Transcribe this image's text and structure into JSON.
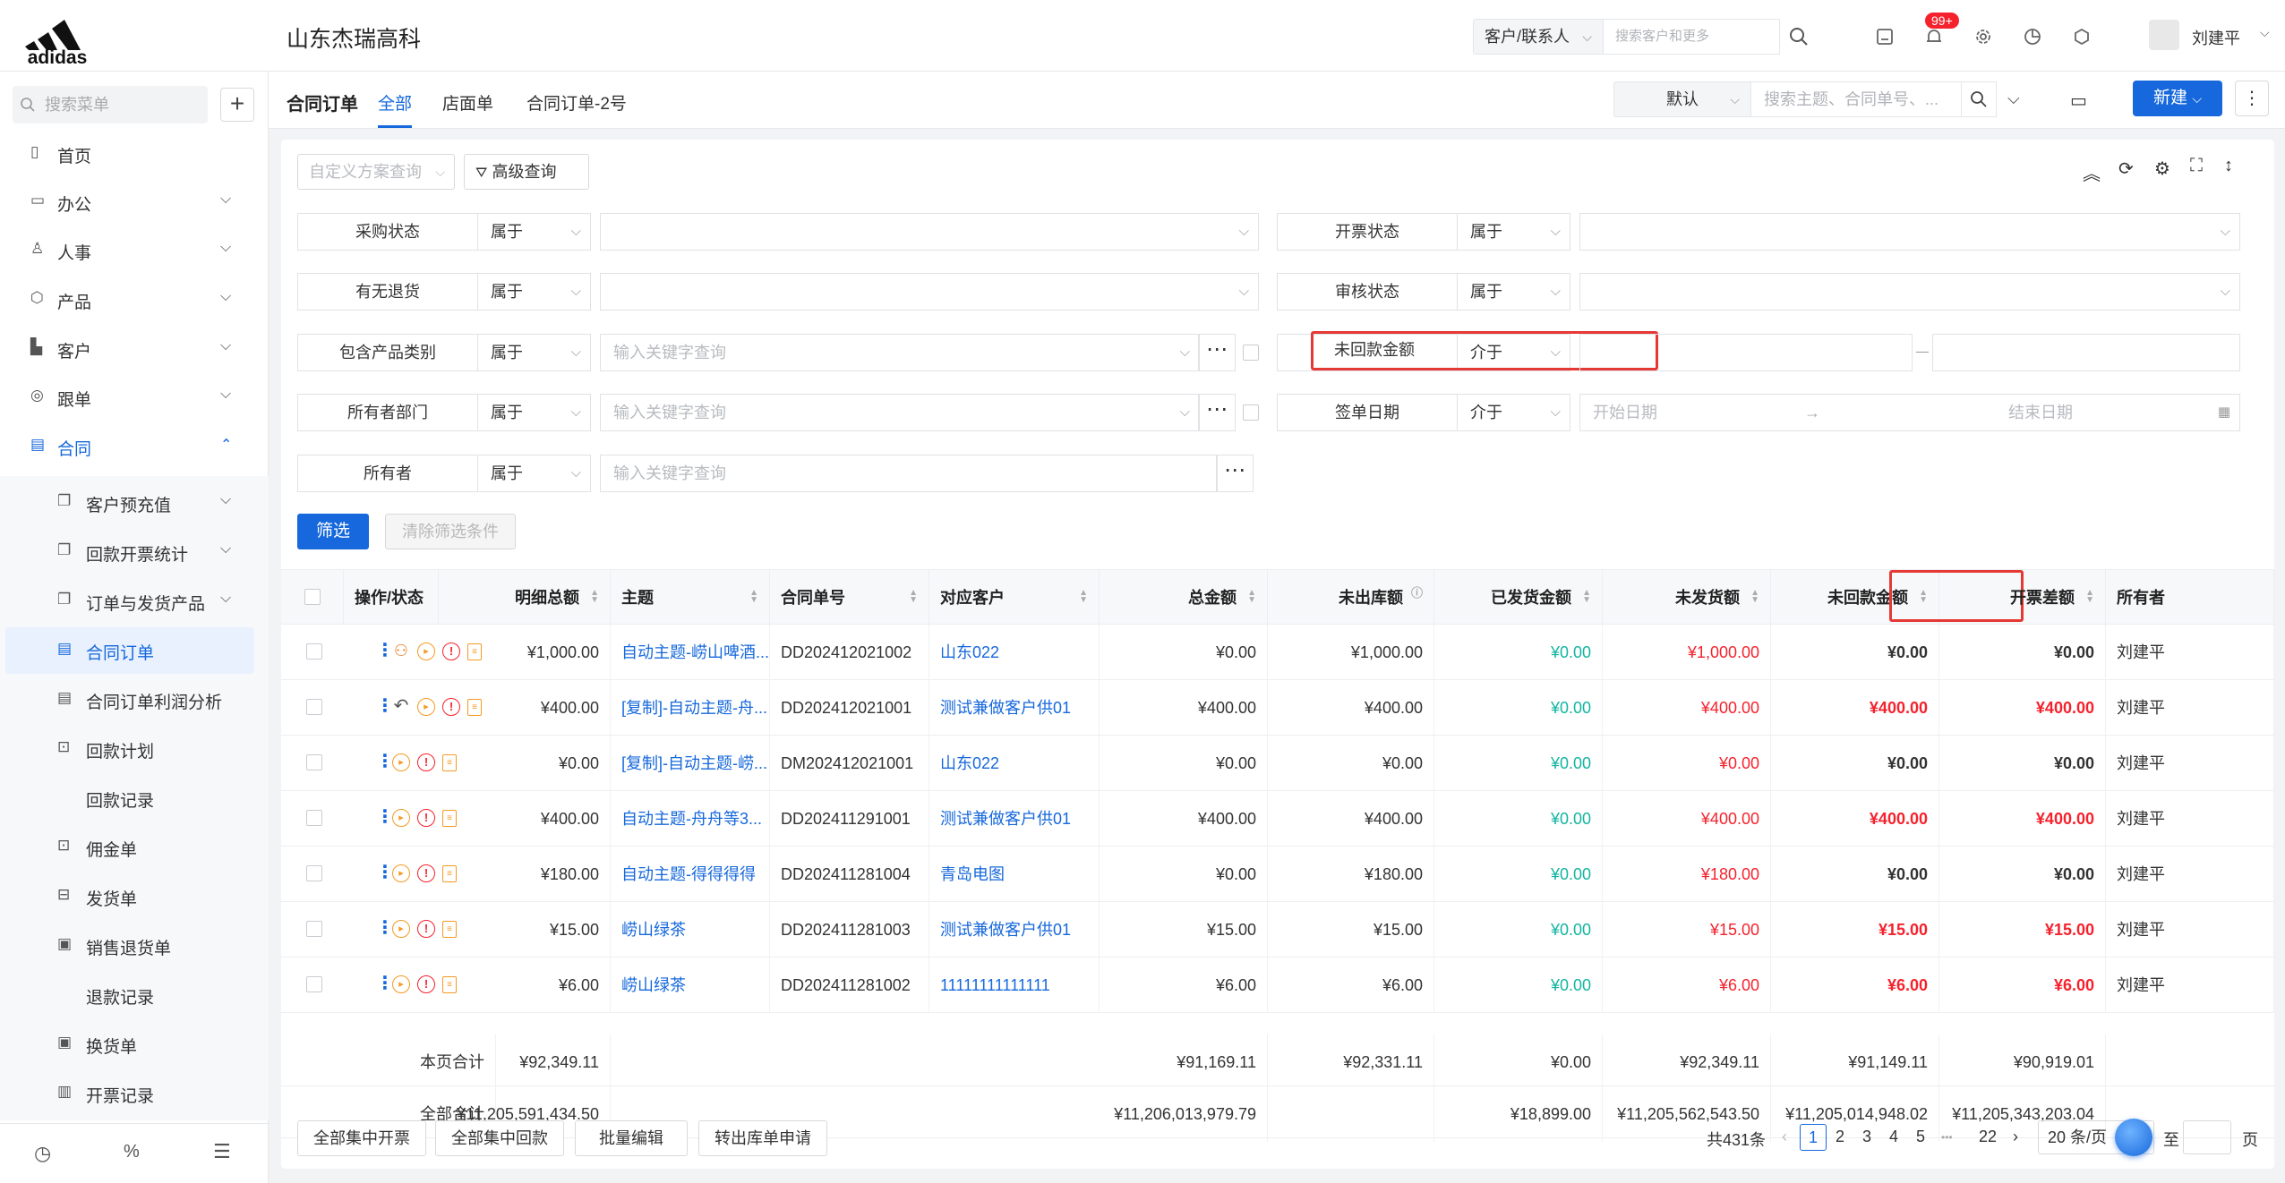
{
  "brand": {
    "logo_text": "adidas"
  },
  "header": {
    "company": "山东杰瑞高科",
    "search_scope": "客户/联系人",
    "search_placeholder": "搜索客户和更多",
    "notification_badge": "99+",
    "username": "刘建平"
  },
  "sidebar": {
    "search_placeholder": "搜索菜单",
    "items": [
      {
        "label": "首页",
        "icon": "home-icon"
      },
      {
        "label": "办公",
        "icon": "office-icon"
      },
      {
        "label": "人事",
        "icon": "people-icon"
      },
      {
        "label": "产品",
        "icon": "cube-icon"
      },
      {
        "label": "客户",
        "icon": "building-icon"
      },
      {
        "label": "跟单",
        "icon": "target-icon"
      },
      {
        "label": "合同",
        "icon": "contract-icon"
      }
    ],
    "sub_items": [
      {
        "label": "客户预充值"
      },
      {
        "label": "回款开票统计"
      },
      {
        "label": "订单与发货产品"
      },
      {
        "label": "合同订单"
      },
      {
        "label": "合同订单利润分析"
      },
      {
        "label": "回款计划"
      },
      {
        "label": "回款记录"
      },
      {
        "label": "佣金单"
      },
      {
        "label": "发货单"
      },
      {
        "label": "销售退货单"
      },
      {
        "label": "退款记录"
      },
      {
        "label": "换货单"
      },
      {
        "label": "开票记录"
      }
    ]
  },
  "tabs": {
    "title": "合同订单",
    "items": [
      "全部",
      "店面单",
      "合同订单-2号"
    ],
    "view_select": "默认",
    "search_placeholder": "搜索主题、合同单号、...",
    "new_label": "新建"
  },
  "filters": {
    "custom_query": "自定义方案查询",
    "advanced": "高级查询",
    "rows": [
      {
        "label": "采购状态",
        "op": "属于",
        "value": ""
      },
      {
        "label": "开票状态",
        "op": "属于",
        "value": ""
      },
      {
        "label": "有无退货",
        "op": "属于",
        "value": ""
      },
      {
        "label": "审核状态",
        "op": "属于",
        "value": ""
      },
      {
        "label": "包含产品类别",
        "op": "属于",
        "value": "输入关键字查询"
      },
      {
        "label": "未回款金额",
        "op": "介于",
        "value": ""
      },
      {
        "label": "所有者部门",
        "op": "属于",
        "value": "输入关键字查询"
      },
      {
        "label": "签单日期",
        "op": "介于",
        "value": "开始日期",
        "value2": "结束日期"
      },
      {
        "label": "所有者",
        "op": "属于",
        "value": "输入关键字查询"
      }
    ],
    "apply": "筛选",
    "clear": "清除筛选条件"
  },
  "table": {
    "headers": [
      "操作/状态",
      "明细总额",
      "主题",
      "合同单号",
      "对应客户",
      "总金额",
      "未出库额",
      "已发货金额",
      "未发货额",
      "未回款金额",
      "开票差额",
      "所有者"
    ],
    "rows": [
      {
        "ops": "first",
        "detail": "¥1,000.00",
        "subject": "自动主题-崂山啤酒...",
        "no": "DD202412021002",
        "customer": "山东022",
        "total": "¥0.00",
        "unout": "¥1,000.00",
        "shipped": "¥0.00",
        "unshipped": "¥1,000.00",
        "unpaid": "¥0.00",
        "invdiff": "¥0.00",
        "owner": "刘建平"
      },
      {
        "ops": "second",
        "detail": "¥400.00",
        "subject": "[复制]-自动主题-舟...",
        "no": "DD202412021001",
        "customer": "测试兼做客户供01",
        "total": "¥400.00",
        "unout": "¥400.00",
        "shipped": "¥0.00",
        "unshipped": "¥400.00",
        "unpaid": "¥400.00",
        "invdiff": "¥400.00",
        "owner": "刘建平"
      },
      {
        "ops": "std",
        "detail": "¥0.00",
        "subject": "[复制]-自动主题-崂...",
        "no": "DM202412021001",
        "customer": "山东022",
        "total": "¥0.00",
        "unout": "¥0.00",
        "shipped": "¥0.00",
        "unshipped": "¥0.00",
        "unpaid": "¥0.00",
        "invdiff": "¥0.00",
        "owner": "刘建平"
      },
      {
        "ops": "std",
        "detail": "¥400.00",
        "subject": "自动主题-舟舟等3...",
        "no": "DD202411291001",
        "customer": "测试兼做客户供01",
        "total": "¥400.00",
        "unout": "¥400.00",
        "shipped": "¥0.00",
        "unshipped": "¥400.00",
        "unpaid": "¥400.00",
        "invdiff": "¥400.00",
        "owner": "刘建平"
      },
      {
        "ops": "std",
        "detail": "¥180.00",
        "subject": "自动主题-得得得得",
        "no": "DD202411281004",
        "customer": "青岛电图",
        "total": "¥0.00",
        "unout": "¥180.00",
        "shipped": "¥0.00",
        "unshipped": "¥180.00",
        "unpaid": "¥0.00",
        "invdiff": "¥0.00",
        "owner": "刘建平"
      },
      {
        "ops": "std",
        "detail": "¥15.00",
        "subject": "崂山绿茶",
        "no": "DD202411281003",
        "customer": "测试兼做客户供01",
        "total": "¥15.00",
        "unout": "¥15.00",
        "shipped": "¥0.00",
        "unshipped": "¥15.00",
        "unpaid": "¥15.00",
        "invdiff": "¥15.00",
        "owner": "刘建平"
      },
      {
        "ops": "std",
        "detail": "¥6.00",
        "subject": "崂山绿茶",
        "no": "DD202411281002",
        "customer": "11111111111111",
        "total": "¥6.00",
        "unout": "¥6.00",
        "shipped": "¥0.00",
        "unshipped": "¥6.00",
        "unpaid": "¥6.00",
        "invdiff": "¥6.00",
        "owner": "刘建平"
      }
    ],
    "page_sum": {
      "label": "本页合计",
      "detail": "¥92,349.11",
      "total": "¥91,169.11",
      "unout": "¥92,331.11",
      "shipped": "¥0.00",
      "unshipped": "¥92,349.11",
      "unpaid": "¥91,149.11",
      "invdiff": "¥90,919.01"
    },
    "all_sum": {
      "label": "全部合计",
      "detail": "¥11,205,591,434.50",
      "total": "¥11,206,013,979.79",
      "unout": "",
      "shipped": "¥18,899.00",
      "unshipped": "¥11,205,562,543.50",
      "unpaid": "¥11,205,014,948.02",
      "invdiff": "¥11,205,343,203.04"
    }
  },
  "bottom": {
    "buttons": [
      "全部集中开票",
      "全部集中回款",
      "批量编辑",
      "转出库单申请"
    ],
    "total": "共431条",
    "pages": [
      "1",
      "2",
      "3",
      "4",
      "5",
      "•••",
      "22"
    ],
    "page_size": "20 条/页",
    "goto": "至",
    "page_unit": "页"
  },
  "colors": {
    "accent": "#1668dc",
    "red": "#f5222d",
    "green": "#13b5a0",
    "highlight": "#e53935"
  }
}
